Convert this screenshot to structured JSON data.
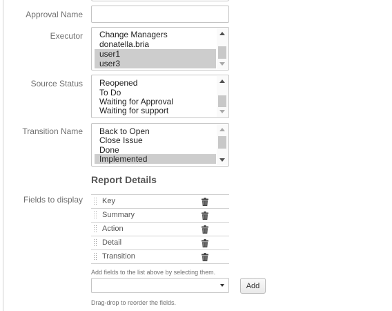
{
  "form": {
    "approval_name": {
      "label": "Approval Name",
      "value": ""
    },
    "executor": {
      "label": "Executor",
      "options": [
        {
          "text": "Change Managers",
          "selected": false
        },
        {
          "text": "donatella.bria",
          "selected": false
        },
        {
          "text": "user1",
          "selected": true
        },
        {
          "text": "user3",
          "selected": true
        }
      ]
    },
    "source_status": {
      "label": "Source Status",
      "options": [
        {
          "text": "Reopened",
          "selected": false
        },
        {
          "text": "To Do",
          "selected": false
        },
        {
          "text": "Waiting for Approval",
          "selected": false
        },
        {
          "text": "Waiting for support",
          "selected": false
        }
      ]
    },
    "transition_name": {
      "label": "Transition Name",
      "options": [
        {
          "text": "Back to Open",
          "selected": false
        },
        {
          "text": "Close Issue",
          "selected": false
        },
        {
          "text": "Done",
          "selected": false
        },
        {
          "text": "Implemented",
          "selected": true
        }
      ]
    }
  },
  "report_details": {
    "title": "Report Details",
    "fields_label": "Fields to display",
    "fields": [
      {
        "name": "Key"
      },
      {
        "name": "Summary"
      },
      {
        "name": "Action"
      },
      {
        "name": "Detail"
      },
      {
        "name": "Transition"
      }
    ],
    "add_hint": "Add fields to the list above by selecting them.",
    "field_select_value": "",
    "add_button_label": "Add",
    "reorder_hint": "Drag-drop to reorder the fields."
  },
  "icons": {
    "delete": "trash-icon",
    "drag": "drag-handle-icon",
    "scroll_up": "chevron-up-icon",
    "scroll_down": "chevron-down-icon",
    "select_caret": "chevron-down-icon"
  },
  "colors": {
    "selected_option_bg": "#cdcdcd",
    "label_text": "#707070",
    "border": "#c4c4c4"
  }
}
